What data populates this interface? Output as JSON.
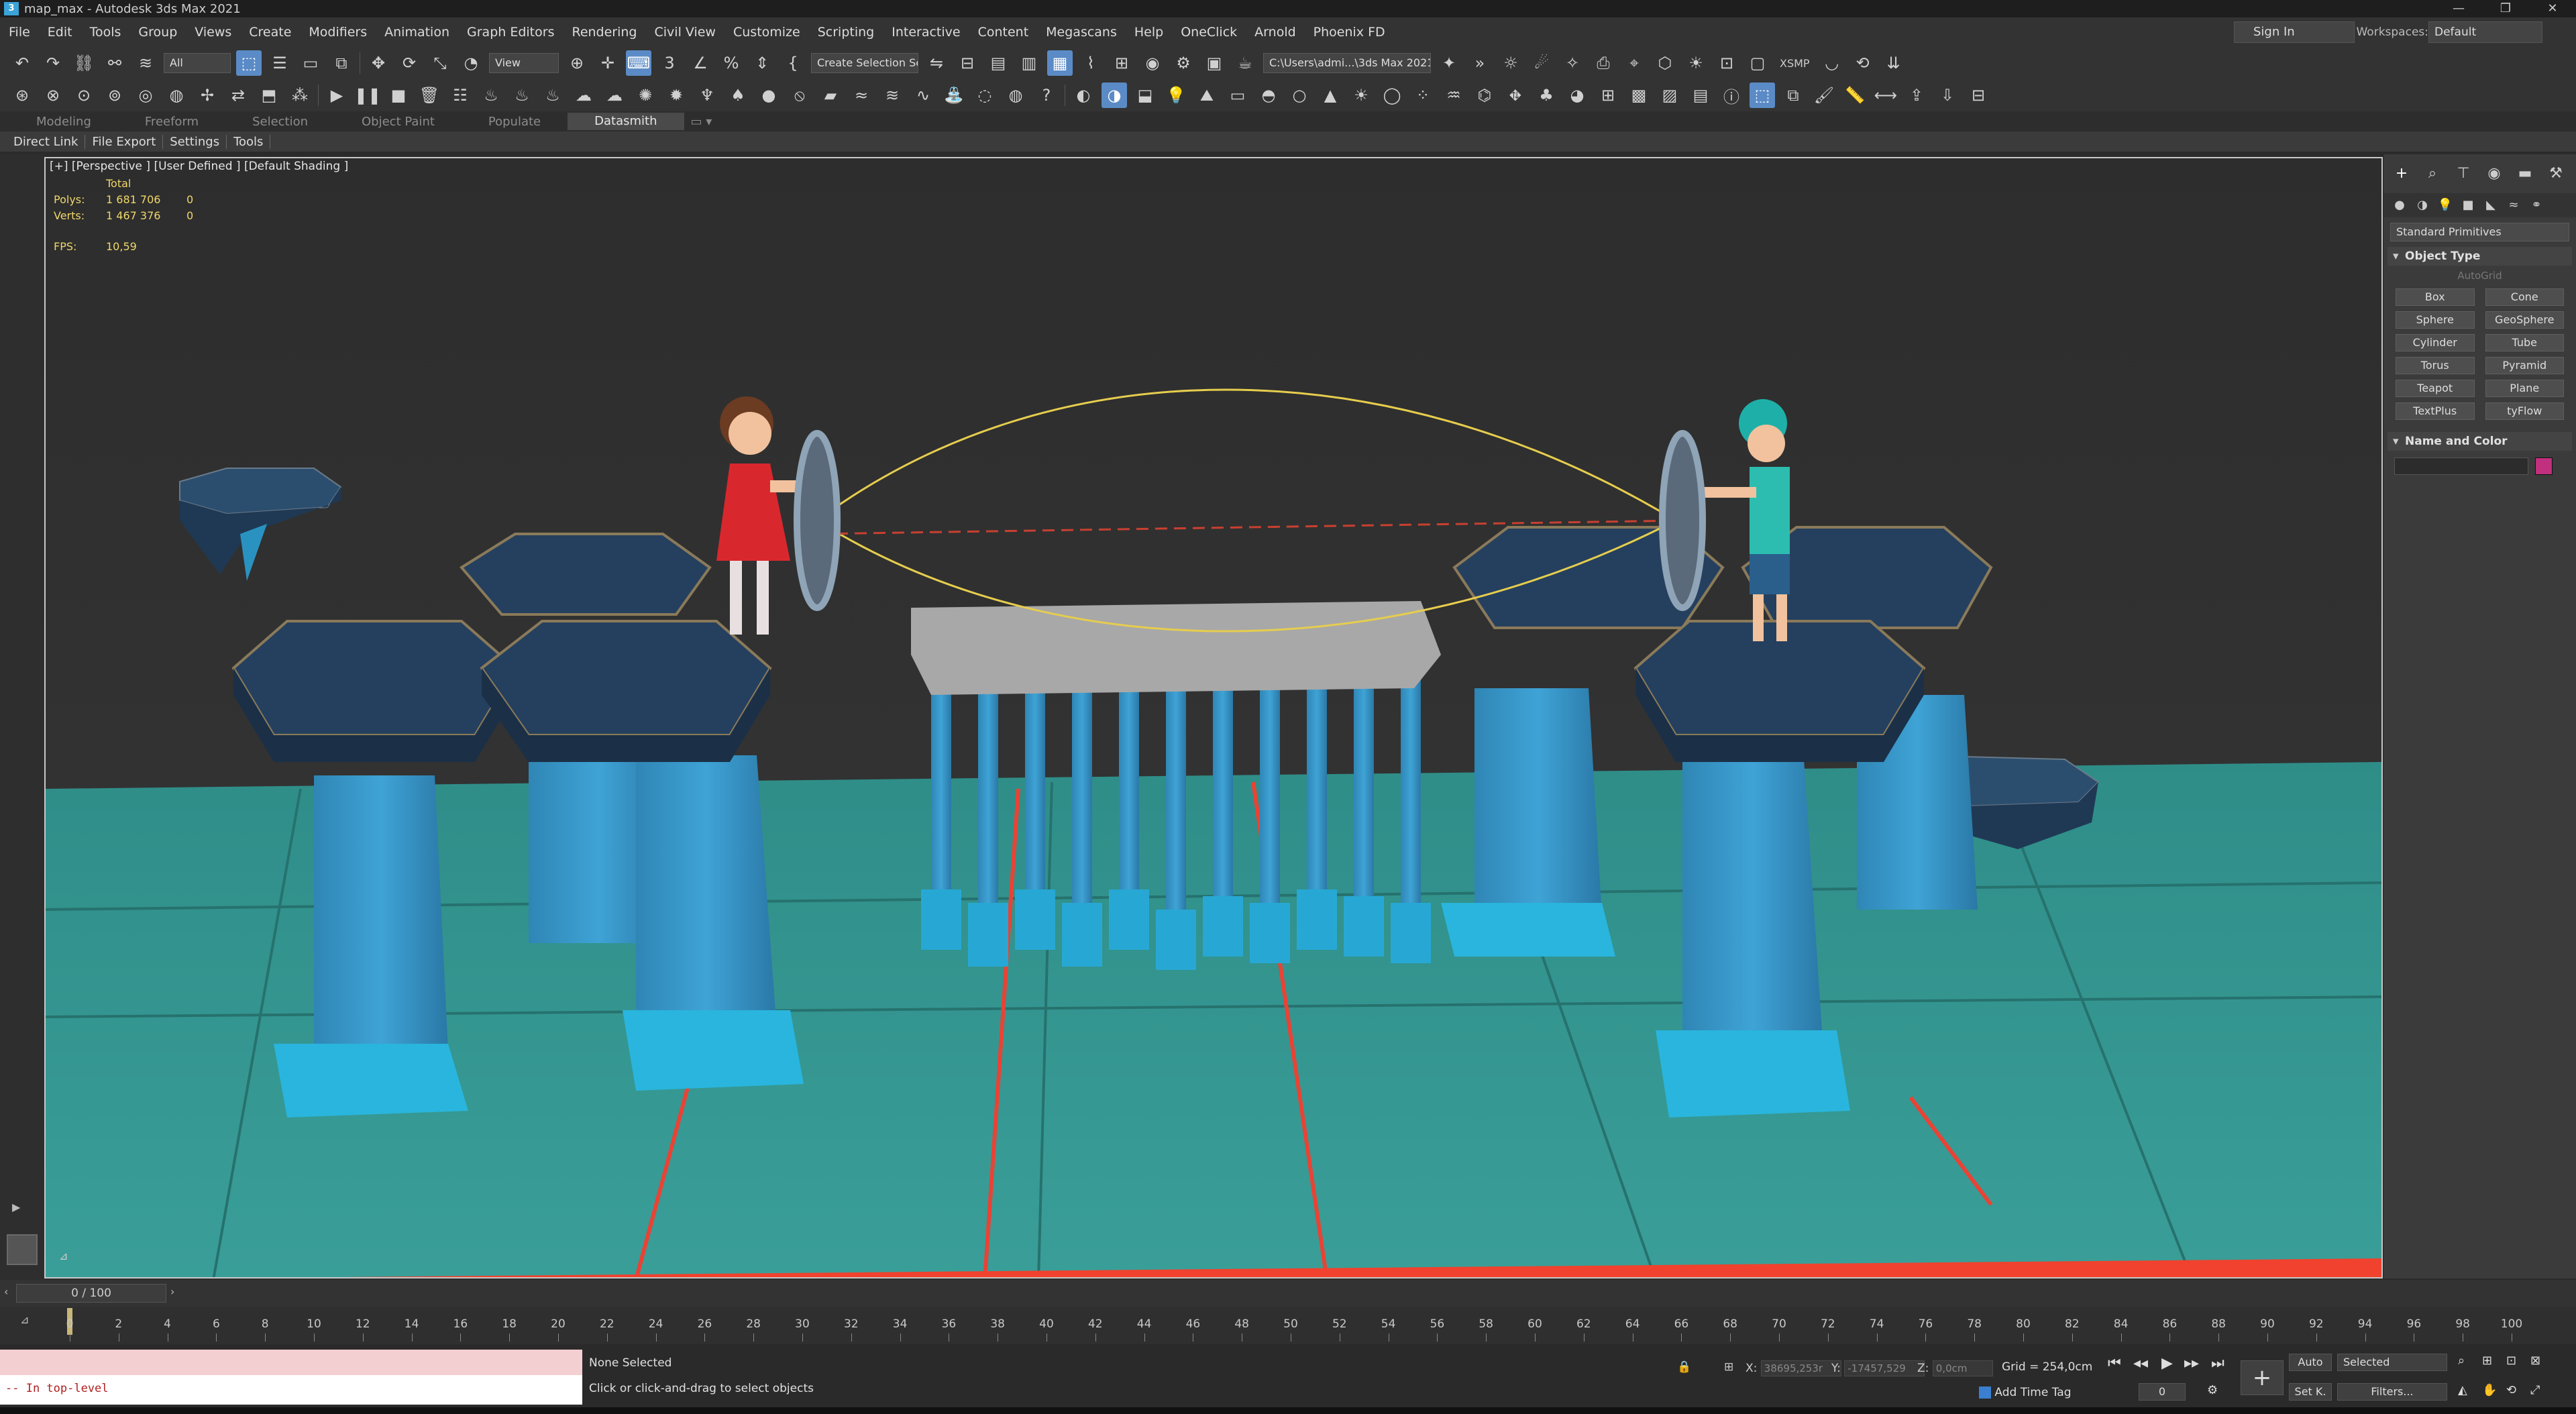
{
  "window": {
    "title": "map_max - Autodesk 3ds Max 2021",
    "logo": "3",
    "controls": [
      "—",
      "❐",
      "✕"
    ]
  },
  "menu": {
    "items": [
      "File",
      "Edit",
      "Tools",
      "Group",
      "Views",
      "Create",
      "Modifiers",
      "Animation",
      "Graph Editors",
      "Rendering",
      "Civil View",
      "Customize",
      "Scripting",
      "Interactive",
      "Content",
      "Megascans",
      "Help",
      "OneClick",
      "Arnold",
      "Phoenix FD"
    ],
    "sign_in": "Sign In",
    "workspaces_label": "Workspaces:",
    "workspace_value": "Default"
  },
  "toolbar": {
    "selection_filter": "All",
    "ref_coord": "View",
    "selection_set": "Create Selection Set",
    "project_path": "C:\\Users\\admi...\\3ds Max 2021",
    "xsmp": "XSMP"
  },
  "ribbon": {
    "tabs": [
      "Modeling",
      "Freeform",
      "Selection",
      "Object Paint",
      "Populate",
      "Datasmith"
    ],
    "active": "Datasmith"
  },
  "subtabs": [
    "Direct Link",
    "File Export",
    "Settings",
    "Tools"
  ],
  "viewport": {
    "label": "[+] [Perspective ] [User Defined ] [Default Shading ]",
    "stats_header": "Total",
    "polys_label": "Polys:",
    "polys_total": "1 681 706",
    "polys_sel": "0",
    "verts_label": "Verts:",
    "verts_total": "1 467 376",
    "verts_sel": "0",
    "fps_label": "FPS:",
    "fps_value": "10,59"
  },
  "command_panel": {
    "category": "Standard Primitives",
    "object_type_title": "Object Type",
    "autogrid": "AutoGrid",
    "primitives": [
      "Box",
      "Cone",
      "Sphere",
      "GeoSphere",
      "Cylinder",
      "Tube",
      "Torus",
      "Pyramid",
      "Teapot",
      "Plane",
      "TextPlus",
      "tyFlow"
    ],
    "name_color_title": "Name and Color",
    "swatch_color": "#c0307f"
  },
  "timeline": {
    "frame_display": "0 / 100",
    "ticks": [
      "0",
      "2",
      "4",
      "6",
      "8",
      "10",
      "12",
      "14",
      "16",
      "18",
      "20",
      "22",
      "24",
      "26",
      "28",
      "30",
      "32",
      "34",
      "36",
      "38",
      "40",
      "42",
      "44",
      "46",
      "48",
      "50",
      "52",
      "54",
      "56",
      "58",
      "60",
      "62",
      "64",
      "66",
      "68",
      "70",
      "72",
      "74",
      "76",
      "78",
      "80",
      "82",
      "84",
      "86",
      "88",
      "90",
      "92",
      "94",
      "96",
      "98",
      "100"
    ]
  },
  "status": {
    "maxscript_output": "-- In top-level",
    "selection": "None Selected",
    "prompt": "Click or click-and-drag to select objects",
    "x_label": "X:",
    "x_value": "38695,253r",
    "y_label": "Y:",
    "y_value": "-17457,529",
    "z_label": "Z:",
    "z_value": "0,0cm",
    "grid": "Grid = 254,0cm",
    "add_time_tag": "Add Time Tag",
    "auto_key": "Auto",
    "set_key": "Set K.",
    "key_mode": "Selected",
    "filters": "Filters...",
    "frame_field": "0"
  }
}
